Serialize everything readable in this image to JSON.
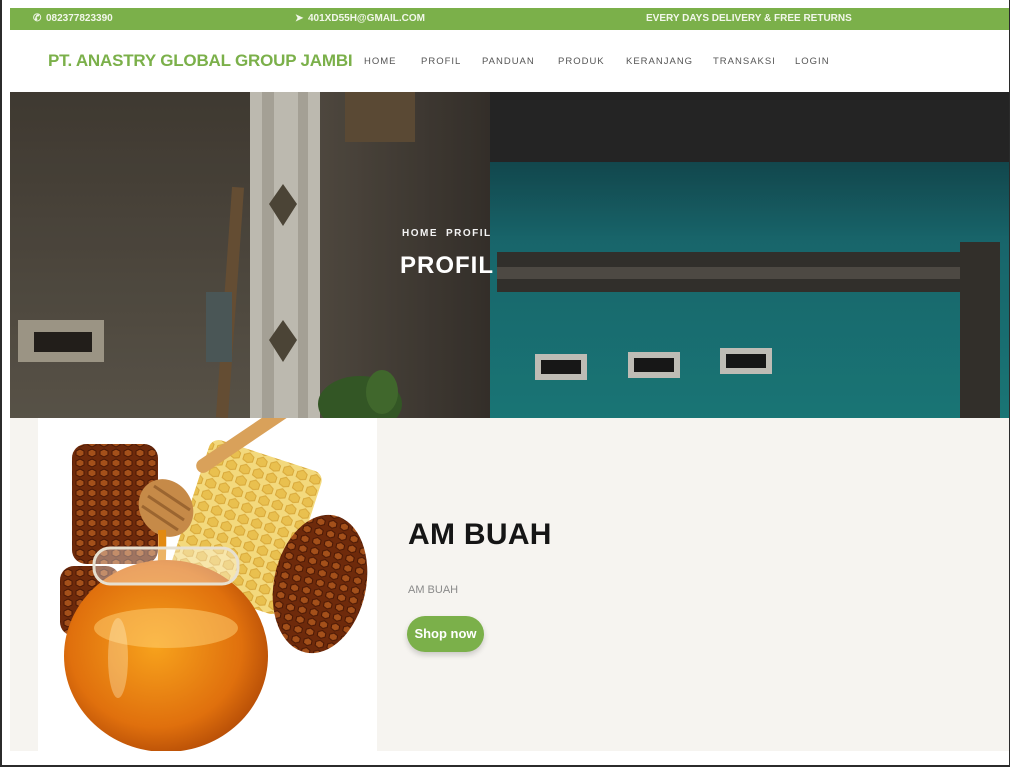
{
  "topbar": {
    "phone": "082377823390",
    "email": "401XD55H@GMAIL.COM",
    "delivery": "EVERY DAYS DELIVERY & FREE RETURNS",
    "phone_icon": "phone-icon",
    "email_icon": "send-icon"
  },
  "header": {
    "brand": "PT. ANASTRY GLOBAL GROUP JAMBI",
    "nav": [
      "HOME",
      "PROFIL",
      "PANDUAN",
      "PRODUK",
      "KERANJANG",
      "TRANSAKSI",
      "LOGIN"
    ]
  },
  "hero": {
    "breadcrumb": [
      "HOME",
      "PROFIL"
    ],
    "title": "PROFIL"
  },
  "product": {
    "title": "AM BUAH",
    "subtitle": "AM BUAH",
    "button": "Shop now"
  },
  "colors": {
    "accent": "#7bb04a",
    "section_bg": "#f6f4f0"
  }
}
